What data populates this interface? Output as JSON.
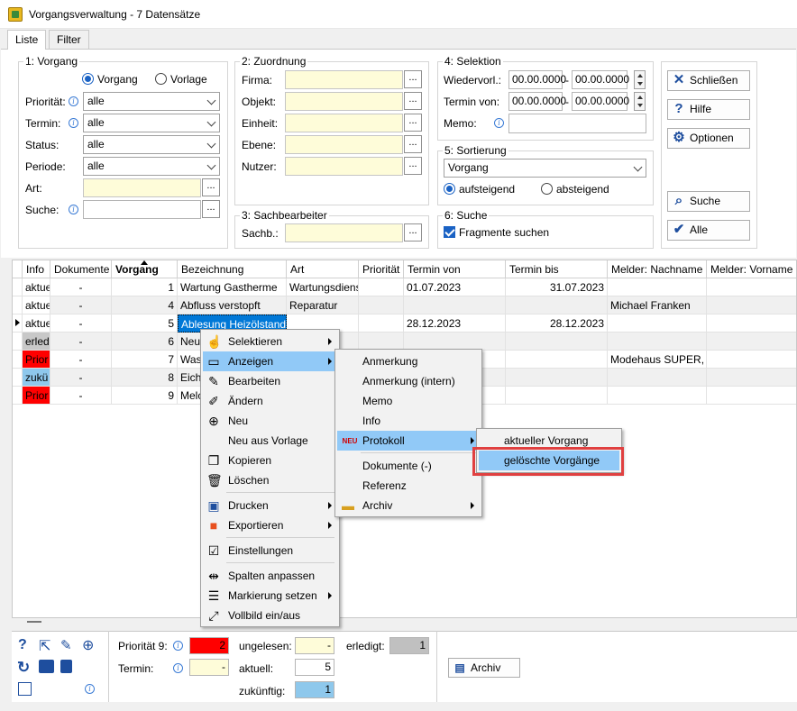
{
  "window": {
    "title": "Vorgangsverwaltung - 7 Datensätze"
  },
  "tabs": [
    {
      "label": "Liste"
    },
    {
      "label": "Filter"
    }
  ],
  "g1": {
    "title": "1: Vorgang",
    "radio_a": "Vorgang",
    "radio_b": "Vorlage",
    "prio_label": "Priorität:",
    "prio_value": "alle",
    "termin_label": "Termin:",
    "termin_value": "alle",
    "status_label": "Status:",
    "status_value": "alle",
    "periode_label": "Periode:",
    "periode_value": "alle",
    "art_label": "Art:",
    "suche_label": "Suche:"
  },
  "g2": {
    "title": "2: Zuordnung",
    "firma": "Firma:",
    "objekt": "Objekt:",
    "einheit": "Einheit:",
    "ebene": "Ebene:",
    "nutzer": "Nutzer:"
  },
  "g3": {
    "title": "3: Sachbearbeiter",
    "sachb": "Sachb.:"
  },
  "g4": {
    "title": "4: Selektion",
    "wv_label": "Wiedervorl.:",
    "wv_from": "00.00.0000",
    "wv_to": "00.00.0000",
    "tv_label": "Termin von:",
    "tv_from": "00.00.0000",
    "tv_to": "00.00.0000",
    "memo_label": "Memo:",
    "dash": "-"
  },
  "g5": {
    "title": "5: Sortierung",
    "sort_value": "Vorgang",
    "asc": "aufsteigend",
    "desc": "absteigend"
  },
  "g6": {
    "title": "6: Suche",
    "frag": "Fragmente suchen"
  },
  "buttons": {
    "close": "Schließen",
    "help": "Hilfe",
    "options": "Optionen",
    "search": "Suche",
    "all": "Alle"
  },
  "dots": "...",
  "grid": {
    "headers": [
      "Info",
      "Dokumente",
      "Vorgang",
      "Bezeichnung",
      "Art",
      "Priorität",
      "Termin von",
      "Termin bis",
      "Melder: Nachname",
      "Melder: Vorname"
    ],
    "rows": [
      {
        "info": "aktue",
        "doc": "-",
        "nr": "1",
        "bez": "Wartung Gastherme",
        "art": "Wartungsdiens",
        "tv": "01.07.2023",
        "tb": "31.07.2023",
        "mn": ""
      },
      {
        "info": "aktue",
        "doc": "-",
        "nr": "4",
        "bez": "Abfluss verstopft",
        "art": "Reparatur",
        "tv": "",
        "tb": "",
        "mn": "Michael Franken"
      },
      {
        "info": "aktue",
        "doc": "-",
        "nr": "5",
        "bez": "Ablesung Heizölstand",
        "art": "",
        "tv": "28.12.2023",
        "tb": "28.12.2023",
        "mn": ""
      },
      {
        "info": "erled",
        "doc": "-",
        "nr": "6",
        "bez": "Neu",
        "art": "",
        "tv": "",
        "tb": "",
        "mn": ""
      },
      {
        "info": "Prior",
        "doc": "-",
        "nr": "7",
        "bez": "Was",
        "art": "",
        "tv": "",
        "tb": "",
        "mn": "Modehaus SUPER, F"
      },
      {
        "info": "zukü",
        "doc": "-",
        "nr": "8",
        "bez": "Eich",
        "art": "",
        "tv": "",
        "tb": "",
        "mn": ""
      },
      {
        "info": "Prior",
        "doc": "-",
        "nr": "9",
        "bez": "Melc",
        "art": "",
        "tv": "",
        "tb": "",
        "mn": ""
      }
    ]
  },
  "menu1": [
    "Selektieren",
    "Anzeigen",
    "Bearbeiten",
    "Ändern",
    "Neu",
    "Neu aus Vorlage",
    "Kopieren",
    "Löschen",
    "Drucken",
    "Exportieren",
    "Einstellungen",
    "Spalten anpassen",
    "Markierung setzen",
    "Vollbild ein/aus"
  ],
  "menu2": [
    "Anmerkung",
    "Anmerkung (intern)",
    "Memo",
    "Info",
    "Protokoll",
    "Dokumente (-)",
    "Referenz",
    "Archiv"
  ],
  "menu2_neu": "NEU",
  "menu3": [
    "aktueller Vorgang",
    "gelöschte Vorgänge"
  ],
  "status": {
    "prio9": "Priorität 9:",
    "prio9_val": "2",
    "termin": "Termin:",
    "termin_val": "-",
    "ungelesen": "ungelesen:",
    "ungelesen_val": "-",
    "aktuell": "aktuell:",
    "aktuell_val": "5",
    "zukuenftig": "zukünftig:",
    "zukuenftig_val": "1",
    "erledigt": "erledigt:",
    "erledigt_val": "1",
    "archiv": "Archiv"
  },
  "colors": {
    "selection": "#0078d7",
    "menu_highlight": "#91c9f7",
    "red": "#ff0000",
    "blue_cell": "#8ec8ec",
    "yellow": "#fefcd9"
  }
}
